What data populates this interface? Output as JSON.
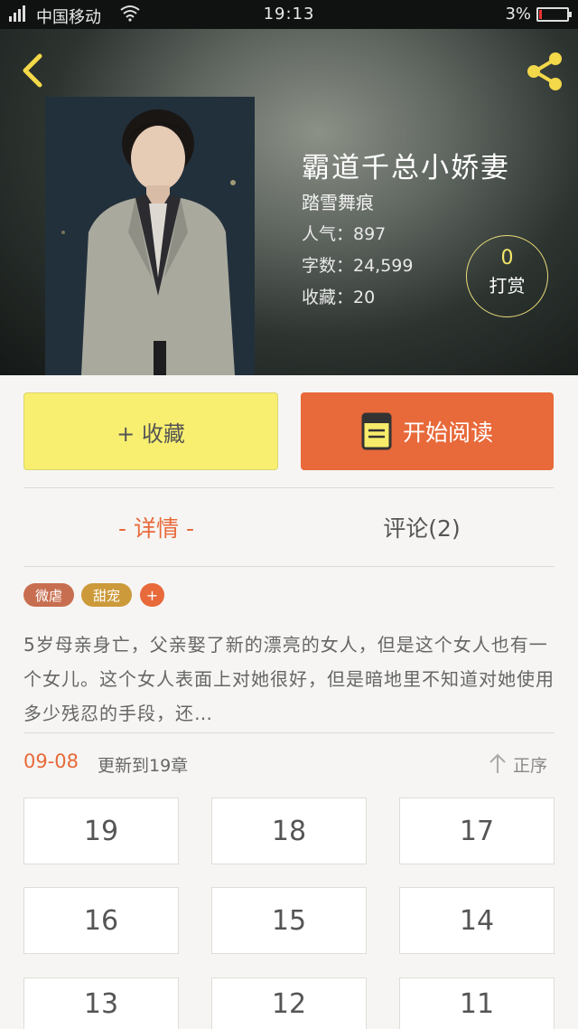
{
  "status_bar": {
    "network": "2G",
    "carrier": "中国移动",
    "time": "19:13",
    "battery": "3%"
  },
  "book": {
    "title": "霸道千总小娇妻",
    "author": "踏雪舞痕",
    "popularity": "人气：897",
    "word_count": "字数：24,599",
    "favorites": "收藏：20",
    "reward_count": "0",
    "reward_label": "打赏"
  },
  "actions": {
    "favorite": "+ 收藏",
    "read": "开始阅读"
  },
  "tabs": {
    "details": "- 详情 -",
    "comments": "评论(2)"
  },
  "tags": [
    "微虐",
    "甜宠"
  ],
  "tag_add": "+",
  "description": "5岁母亲身亡，父亲娶了新的漂亮的女人，但是这个女人也有一个女儿。这个女人表面上对她很好，但是暗地里不知道对她使用多少残忍的手段，还…",
  "updates": {
    "date": "09-08",
    "text": "更新到19章",
    "order": "正序"
  },
  "chapters": [
    "19",
    "18",
    "17",
    "16",
    "15",
    "14",
    "13",
    "12",
    "11"
  ],
  "icons": [
    "back-icon",
    "share-icon",
    "book-icon",
    "sort-up-icon"
  ],
  "colors": {
    "accent": "#e8693a",
    "favorite_button": "#f8ef70",
    "reward_ring": "#e9dc7a"
  }
}
